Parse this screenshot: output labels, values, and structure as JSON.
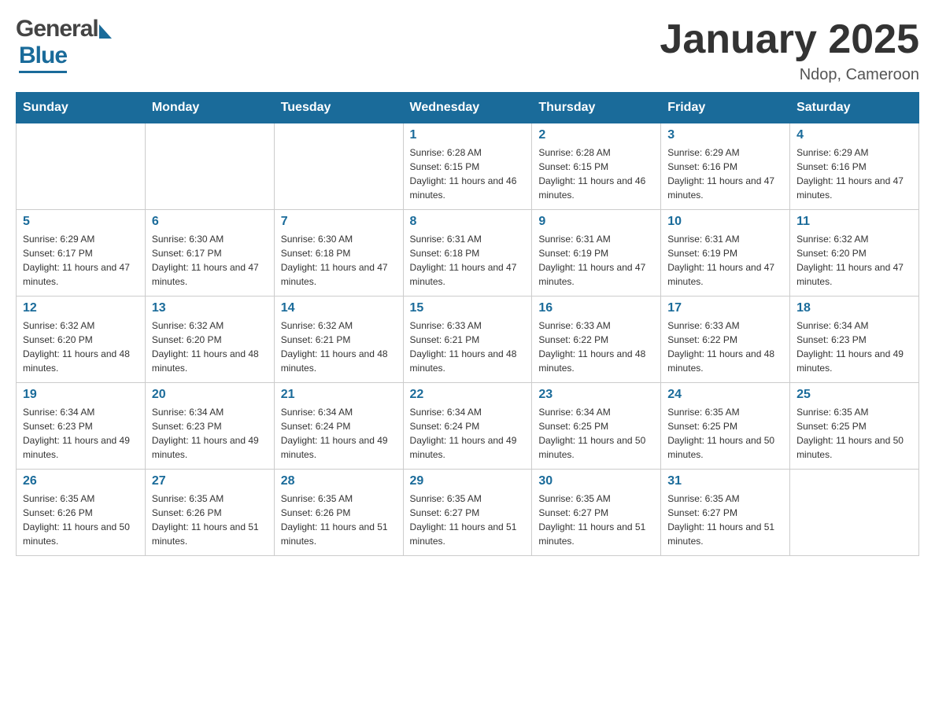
{
  "header": {
    "logo_general": "General",
    "logo_blue": "Blue",
    "month_title": "January 2025",
    "location": "Ndop, Cameroon"
  },
  "days_of_week": [
    "Sunday",
    "Monday",
    "Tuesday",
    "Wednesday",
    "Thursday",
    "Friday",
    "Saturday"
  ],
  "weeks": [
    [
      {
        "day": "",
        "info": ""
      },
      {
        "day": "",
        "info": ""
      },
      {
        "day": "",
        "info": ""
      },
      {
        "day": "1",
        "info": "Sunrise: 6:28 AM\nSunset: 6:15 PM\nDaylight: 11 hours and 46 minutes."
      },
      {
        "day": "2",
        "info": "Sunrise: 6:28 AM\nSunset: 6:15 PM\nDaylight: 11 hours and 46 minutes."
      },
      {
        "day": "3",
        "info": "Sunrise: 6:29 AM\nSunset: 6:16 PM\nDaylight: 11 hours and 47 minutes."
      },
      {
        "day": "4",
        "info": "Sunrise: 6:29 AM\nSunset: 6:16 PM\nDaylight: 11 hours and 47 minutes."
      }
    ],
    [
      {
        "day": "5",
        "info": "Sunrise: 6:29 AM\nSunset: 6:17 PM\nDaylight: 11 hours and 47 minutes."
      },
      {
        "day": "6",
        "info": "Sunrise: 6:30 AM\nSunset: 6:17 PM\nDaylight: 11 hours and 47 minutes."
      },
      {
        "day": "7",
        "info": "Sunrise: 6:30 AM\nSunset: 6:18 PM\nDaylight: 11 hours and 47 minutes."
      },
      {
        "day": "8",
        "info": "Sunrise: 6:31 AM\nSunset: 6:18 PM\nDaylight: 11 hours and 47 minutes."
      },
      {
        "day": "9",
        "info": "Sunrise: 6:31 AM\nSunset: 6:19 PM\nDaylight: 11 hours and 47 minutes."
      },
      {
        "day": "10",
        "info": "Sunrise: 6:31 AM\nSunset: 6:19 PM\nDaylight: 11 hours and 47 minutes."
      },
      {
        "day": "11",
        "info": "Sunrise: 6:32 AM\nSunset: 6:20 PM\nDaylight: 11 hours and 47 minutes."
      }
    ],
    [
      {
        "day": "12",
        "info": "Sunrise: 6:32 AM\nSunset: 6:20 PM\nDaylight: 11 hours and 48 minutes."
      },
      {
        "day": "13",
        "info": "Sunrise: 6:32 AM\nSunset: 6:20 PM\nDaylight: 11 hours and 48 minutes."
      },
      {
        "day": "14",
        "info": "Sunrise: 6:32 AM\nSunset: 6:21 PM\nDaylight: 11 hours and 48 minutes."
      },
      {
        "day": "15",
        "info": "Sunrise: 6:33 AM\nSunset: 6:21 PM\nDaylight: 11 hours and 48 minutes."
      },
      {
        "day": "16",
        "info": "Sunrise: 6:33 AM\nSunset: 6:22 PM\nDaylight: 11 hours and 48 minutes."
      },
      {
        "day": "17",
        "info": "Sunrise: 6:33 AM\nSunset: 6:22 PM\nDaylight: 11 hours and 48 minutes."
      },
      {
        "day": "18",
        "info": "Sunrise: 6:34 AM\nSunset: 6:23 PM\nDaylight: 11 hours and 49 minutes."
      }
    ],
    [
      {
        "day": "19",
        "info": "Sunrise: 6:34 AM\nSunset: 6:23 PM\nDaylight: 11 hours and 49 minutes."
      },
      {
        "day": "20",
        "info": "Sunrise: 6:34 AM\nSunset: 6:23 PM\nDaylight: 11 hours and 49 minutes."
      },
      {
        "day": "21",
        "info": "Sunrise: 6:34 AM\nSunset: 6:24 PM\nDaylight: 11 hours and 49 minutes."
      },
      {
        "day": "22",
        "info": "Sunrise: 6:34 AM\nSunset: 6:24 PM\nDaylight: 11 hours and 49 minutes."
      },
      {
        "day": "23",
        "info": "Sunrise: 6:34 AM\nSunset: 6:25 PM\nDaylight: 11 hours and 50 minutes."
      },
      {
        "day": "24",
        "info": "Sunrise: 6:35 AM\nSunset: 6:25 PM\nDaylight: 11 hours and 50 minutes."
      },
      {
        "day": "25",
        "info": "Sunrise: 6:35 AM\nSunset: 6:25 PM\nDaylight: 11 hours and 50 minutes."
      }
    ],
    [
      {
        "day": "26",
        "info": "Sunrise: 6:35 AM\nSunset: 6:26 PM\nDaylight: 11 hours and 50 minutes."
      },
      {
        "day": "27",
        "info": "Sunrise: 6:35 AM\nSunset: 6:26 PM\nDaylight: 11 hours and 51 minutes."
      },
      {
        "day": "28",
        "info": "Sunrise: 6:35 AM\nSunset: 6:26 PM\nDaylight: 11 hours and 51 minutes."
      },
      {
        "day": "29",
        "info": "Sunrise: 6:35 AM\nSunset: 6:27 PM\nDaylight: 11 hours and 51 minutes."
      },
      {
        "day": "30",
        "info": "Sunrise: 6:35 AM\nSunset: 6:27 PM\nDaylight: 11 hours and 51 minutes."
      },
      {
        "day": "31",
        "info": "Sunrise: 6:35 AM\nSunset: 6:27 PM\nDaylight: 11 hours and 51 minutes."
      },
      {
        "day": "",
        "info": ""
      }
    ]
  ]
}
